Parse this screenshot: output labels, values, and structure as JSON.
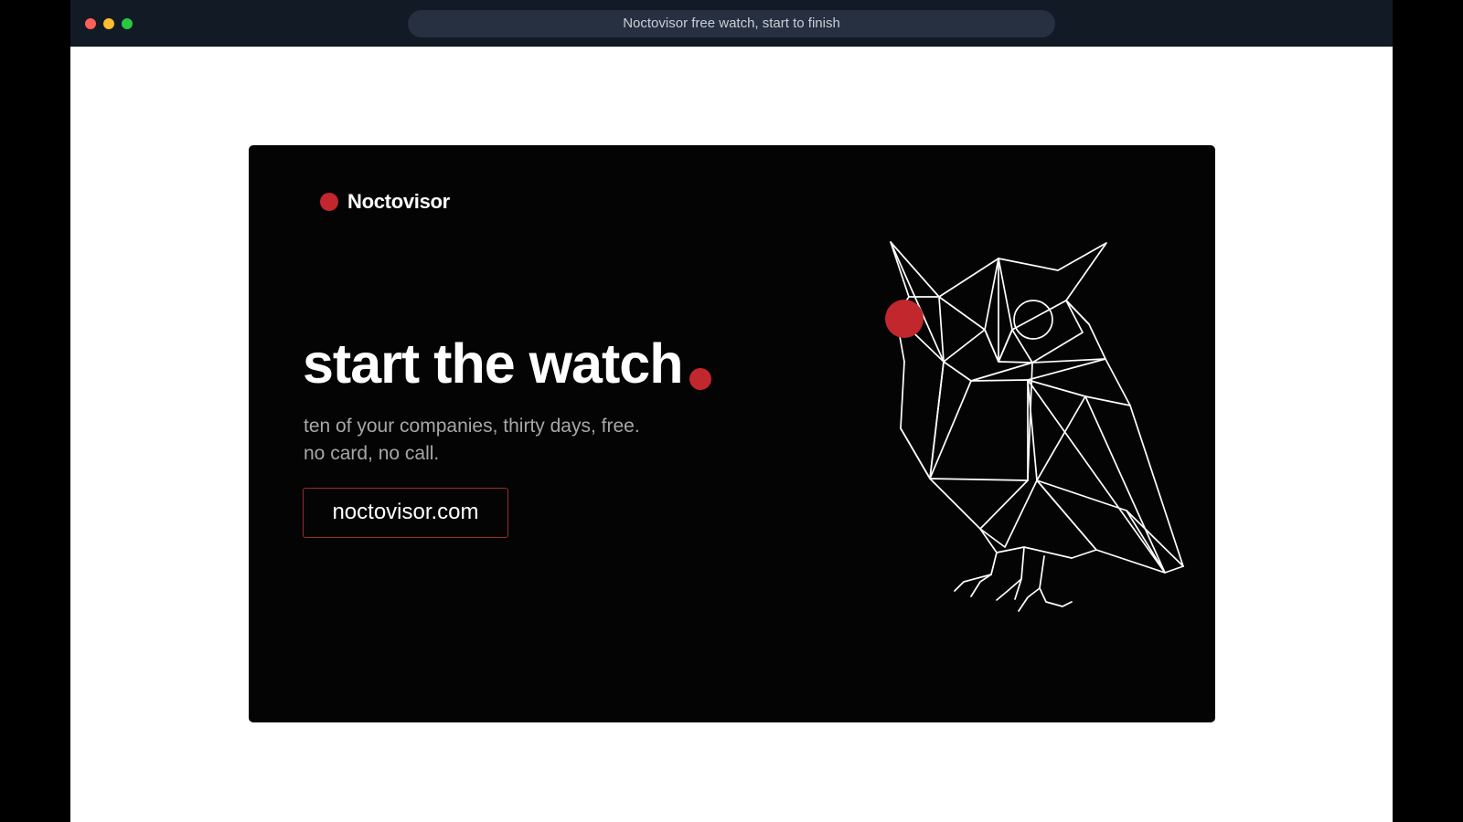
{
  "browser": {
    "tab_title": "Noctovisor free watch, start to finish"
  },
  "brand": {
    "name": "Noctovisor",
    "accent": "#c1272d"
  },
  "hero": {
    "headline": "start the watch",
    "subline_1": "ten of your companies, thirty days, free.",
    "subline_2": "no card, no call.",
    "cta_label": "noctovisor.com"
  },
  "illustration": {
    "icon": "geometric-owl-icon",
    "eye_color": "#c1272d"
  }
}
